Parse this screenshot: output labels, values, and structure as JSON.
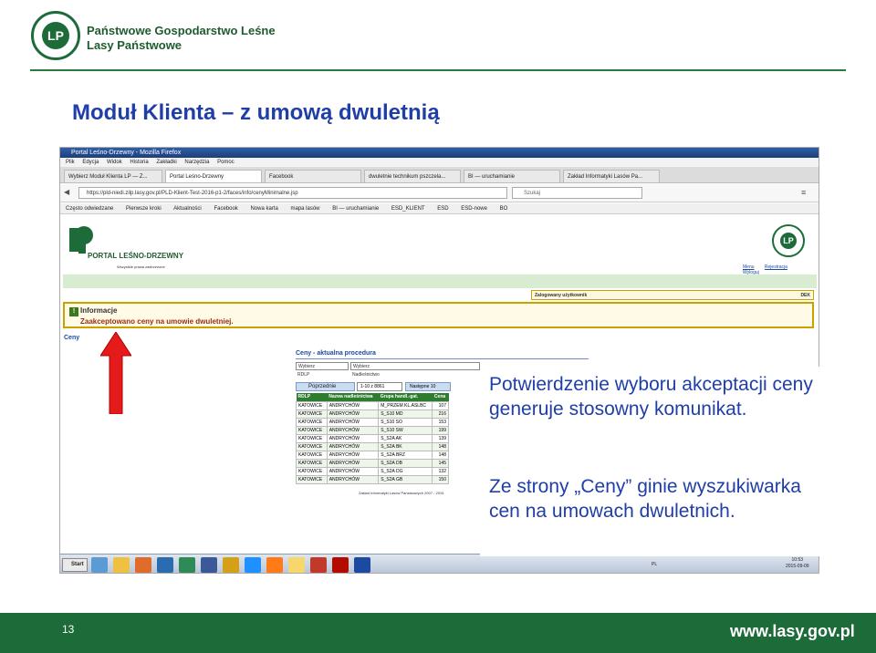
{
  "header": {
    "logo_text": "LP",
    "org_line1": "Państwowe Gospodarstwo Leśne",
    "org_line2": "Lasy Państwowe"
  },
  "slide": {
    "title": "Moduł Klienta – z umową dwuletnią",
    "callout1": "Potwierdzenie wyboru akceptacji ceny generuje stosowny komunikat.",
    "callout2": "Ze strony „Ceny” ginie wyszukiwarka cen na umowach dwuletnich.",
    "page_number": "13",
    "footer_site": "www.lasy.gov.pl"
  },
  "browser": {
    "window_title": "Portal Leśno-Drzewny - Mozilla Firefox",
    "menu": [
      "Plik",
      "Edycja",
      "Widok",
      "Historia",
      "Zakładki",
      "Narzędzia",
      "Pomoc"
    ],
    "tabs": [
      "Wybierz Moduł Klienta LP — Z...",
      "Portal Leśno-Drzewny",
      "Facebook",
      "dwuletnie technikum pszczela...",
      "BI — uruchamianie",
      "Zakład Informatyki Lasów Pa..."
    ],
    "url": "https://pld-niedi.zilp.lasy.gov.pl/PLD-Klient-Test-2016-p1-2/faces/info/cenyMinimalne.jsp",
    "search_placeholder": "Szukaj",
    "bookmarks": [
      "Często odwiedzane",
      "Pierwsze kroki",
      "Aktualności",
      "Facebook",
      "Nowa karta",
      "mapa lasów",
      "BI — uruchamianie",
      "ESD_KLIENT",
      "ESD",
      "ESD-nowe",
      "BO"
    ]
  },
  "page": {
    "portal_name": "PORTAL LEŚNO-DRZEWNY",
    "portal_sub": "Wszystkie prawa zastrzeżone",
    "top_links": [
      "Menu",
      "Rejestracja",
      "Wyloguj"
    ],
    "login_label": "Zalogowany użytkownik",
    "login_suffix": "DEK",
    "info_title": "Informacje",
    "info_message": "Zaakceptowano ceny na umowie dwuletniej.",
    "ceny_link": "Ceny",
    "section_title": "Ceny - aktualna procedura",
    "filter1_value": "Wybierz",
    "filter2_value": "Wybierz",
    "filter1_label": "RDLP",
    "filter2_label": "Nadleśnictwo",
    "prev_button": "Poprzednie",
    "range_value": "1-10 z 8861",
    "next_button": "Następne 10",
    "footer_text": "Zakład Informatyki Lasów Państwowych 2007 - 2015",
    "table": {
      "columns": [
        "RDLP",
        "Nazwa nadleśnictwa",
        "Grupa handl.-gat.",
        "Cena"
      ],
      "rows": [
        [
          "KATOWICE",
          "ANDRYCHÓW",
          "M_PRZEM KL.ASLBC",
          "107"
        ],
        [
          "KATOWICE",
          "ANDRYCHÓW",
          "S_S10 MD",
          "216"
        ],
        [
          "KATOWICE",
          "ANDRYCHÓW",
          "S_S10 SO",
          "153"
        ],
        [
          "KATOWICE",
          "ANDRYCHÓW",
          "S_S10 SW",
          "199"
        ],
        [
          "KATOWICE",
          "ANDRYCHÓW",
          "S_S2A AK",
          "139"
        ],
        [
          "KATOWICE",
          "ANDRYCHÓW",
          "S_S2A BK",
          "148"
        ],
        [
          "KATOWICE",
          "ANDRYCHÓW",
          "S_S2A BRZ",
          "148"
        ],
        [
          "KATOWICE",
          "ANDRYCHÓW",
          "S_S2A DB",
          "145"
        ],
        [
          "KATOWICE",
          "ANDRYCHÓW",
          "S_S2A DG",
          "132"
        ],
        [
          "KATOWICE",
          "ANDRYCHÓW",
          "S_S2A GB",
          "150"
        ]
      ]
    }
  },
  "taskbar": {
    "start_label": "Start",
    "lang": "PL",
    "time": "10:53",
    "date": "2015-09-09"
  },
  "colors": {
    "brand_green": "#1e6b3a",
    "title_blue": "#1f3ea8",
    "arrow_red": "#e31b1b"
  }
}
